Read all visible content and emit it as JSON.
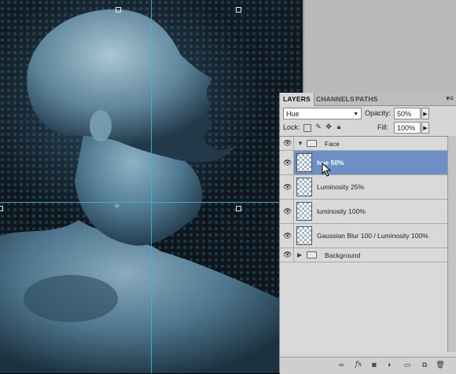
{
  "panel": {
    "tabs": [
      {
        "label": "LAYERS",
        "active": true
      },
      {
        "label": "CHANNELS",
        "active": false
      },
      {
        "label": "PATHS",
        "active": false
      }
    ],
    "menu_icon": "panel-menu-icon"
  },
  "blend": {
    "mode": "Hue",
    "opacity_label": "Opacity:",
    "opacity_value": "50%"
  },
  "lock": {
    "label": "Lock:",
    "fill_label": "Fill:",
    "fill_value": "100%"
  },
  "layers": {
    "group_face": {
      "name": "Face",
      "expanded": true
    },
    "items": [
      {
        "name": "hue 50%",
        "selected": true
      },
      {
        "name": "Luminosity 25%",
        "selected": false
      },
      {
        "name": "luminosity 100%",
        "selected": false
      },
      {
        "name": "Gaussian Blur 100 / Luminosity 100%",
        "selected": false
      }
    ],
    "group_background": {
      "name": "Background",
      "expanded": false
    }
  },
  "colors": {
    "selection": "#6d8fc4",
    "guide": "#3fb3d9",
    "panel_bg": "#d6d6d6"
  },
  "footer_icons": [
    "link-layers-icon",
    "fx-icon",
    "add-mask-icon",
    "adjustment-layer-icon",
    "new-group-icon",
    "new-layer-icon",
    "delete-layer-icon"
  ]
}
